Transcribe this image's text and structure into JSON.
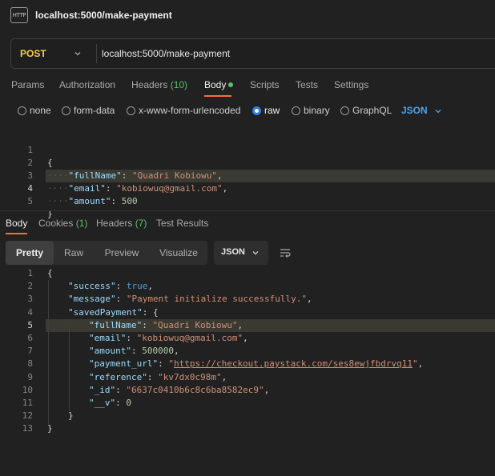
{
  "tab": {
    "title": "localhost:5000/make-payment",
    "icon": "http-file-icon",
    "icon_text": "HTTP"
  },
  "request": {
    "method": "POST",
    "url": "localhost:5000/make-payment",
    "tabs": [
      {
        "label": "Params"
      },
      {
        "label": "Authorization"
      },
      {
        "label": "Headers",
        "count": "(10)"
      },
      {
        "label": "Body",
        "active": true
      },
      {
        "label": "Scripts"
      },
      {
        "label": "Tests"
      },
      {
        "label": "Settings"
      }
    ],
    "body_types": [
      {
        "label": "none"
      },
      {
        "label": "form-data"
      },
      {
        "label": "x-www-form-urlencoded"
      },
      {
        "label": "raw",
        "checked": true
      },
      {
        "label": "binary"
      },
      {
        "label": "GraphQL"
      }
    ],
    "format": "JSON",
    "body_lines": {
      "l1": {
        "num": "1",
        "open": "{"
      },
      "l2": {
        "num": "2",
        "key": "\"fullName\"",
        "sep": ": ",
        "val": "\"Quadri Kobiowu\"",
        "tail": ","
      },
      "l3": {
        "num": "3",
        "key": "\"email\"",
        "sep": ": ",
        "val": "\"kobiowuq@gmail.com\"",
        "tail": ","
      },
      "l4": {
        "num": "4",
        "key": "\"amount\"",
        "sep": ": ",
        "val": "500"
      },
      "l5": {
        "num": "5",
        "close": "}"
      }
    }
  },
  "response": {
    "tabs": [
      {
        "label": "Body",
        "active": true
      },
      {
        "label": "Cookies",
        "count": "(1)"
      },
      {
        "label": "Headers",
        "count": "(7)"
      },
      {
        "label": "Test Results"
      }
    ],
    "views": [
      "Pretty",
      "Raw",
      "Preview",
      "Visualize"
    ],
    "active_view": "Pretty",
    "format": "JSON",
    "lines": {
      "l1": {
        "num": "1",
        "text": "{"
      },
      "l2": {
        "num": "2",
        "key": "\"success\"",
        "sep": ": ",
        "val": "true",
        "tail": ","
      },
      "l3": {
        "num": "3",
        "key": "\"message\"",
        "sep": ": ",
        "val": "\"Payment initialize successfully.\"",
        "tail": ","
      },
      "l4": {
        "num": "4",
        "key": "\"savedPayment\"",
        "sep": ": ",
        "open": "{"
      },
      "l5": {
        "num": "5",
        "key": "\"fullName\"",
        "sep": ": ",
        "val": "\"Quadri Kobiowu\"",
        "tail": ","
      },
      "l6": {
        "num": "6",
        "key": "\"email\"",
        "sep": ": ",
        "val": "\"kobiowuq@gmail.com\"",
        "tail": ","
      },
      "l7": {
        "num": "7",
        "key": "\"amount\"",
        "sep": ": ",
        "val": "500000",
        "tail": ","
      },
      "l8": {
        "num": "8",
        "key": "\"payment_url\"",
        "sep": ": ",
        "q1": "\"",
        "link": "https://checkout.paystack.com/ses8ewjfbdrvq11",
        "q2": "\"",
        "tail": ","
      },
      "l9": {
        "num": "9",
        "key": "\"reference\"",
        "sep": ": ",
        "val": "\"kv7dx0c98m\"",
        "tail": ","
      },
      "l10": {
        "num": "10",
        "key": "\"_id\"",
        "sep": ": ",
        "val": "\"6637c0410b6c8c6ba8582ec9\"",
        "tail": ","
      },
      "l11": {
        "num": "11",
        "key": "\"__v\"",
        "sep": ": ",
        "val": "0"
      },
      "l12": {
        "num": "12",
        "text": "}"
      },
      "l13": {
        "num": "13",
        "text": "}"
      }
    }
  }
}
